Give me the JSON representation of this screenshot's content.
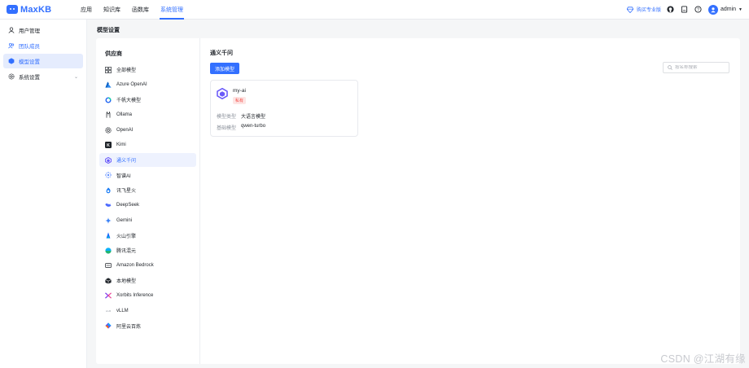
{
  "app": {
    "logo_text": "MaxKB"
  },
  "topnav": {
    "items": [
      {
        "label": "应用",
        "active": false
      },
      {
        "label": "知识库",
        "active": false
      },
      {
        "label": "函数库",
        "active": false
      },
      {
        "label": "系统管理",
        "active": true
      }
    ]
  },
  "topright": {
    "upgrade_label": "购买专业版",
    "username": "admin",
    "icons": [
      "diamond-icon",
      "github-icon",
      "document-icon",
      "help-icon"
    ]
  },
  "sidebar": {
    "items": [
      {
        "label": "用户管理",
        "icon": "user-icon",
        "active": false
      },
      {
        "label": "团队成员",
        "icon": "team-icon",
        "active": false
      },
      {
        "label": "模型设置",
        "icon": "model-icon",
        "active": true
      },
      {
        "label": "系统设置",
        "icon": "gear-icon",
        "active": false,
        "expandable": true
      }
    ]
  },
  "page": {
    "title": "模型设置"
  },
  "providers": {
    "title": "供应商",
    "items": [
      {
        "label": "全部模型",
        "icon": "grid-icon"
      },
      {
        "label": "Azure OpenAI",
        "icon": "azure-icon"
      },
      {
        "label": "千帆大模型",
        "icon": "qianfan-icon"
      },
      {
        "label": "Ollama",
        "icon": "ollama-icon"
      },
      {
        "label": "OpenAI",
        "icon": "openai-icon"
      },
      {
        "label": "Kimi",
        "icon": "kimi-icon"
      },
      {
        "label": "通义千问",
        "icon": "tongyi-icon",
        "active": true
      },
      {
        "label": "智谱AI",
        "icon": "zhipu-icon"
      },
      {
        "label": "讯飞星火",
        "icon": "xunfei-icon"
      },
      {
        "label": "DeepSeek",
        "icon": "deepseek-icon"
      },
      {
        "label": "Gemini",
        "icon": "gemini-icon"
      },
      {
        "label": "火山引擎",
        "icon": "volcano-icon"
      },
      {
        "label": "腾讯混元",
        "icon": "hunyuan-icon"
      },
      {
        "label": "Amazon Bedrock",
        "icon": "bedrock-icon"
      },
      {
        "label": "本地模型",
        "icon": "local-model-icon"
      },
      {
        "label": "Xorbits Inference",
        "icon": "xorbits-icon"
      },
      {
        "label": "vLLM",
        "icon": "vllm-icon"
      },
      {
        "label": "阿里云百炼",
        "icon": "bailian-icon"
      }
    ]
  },
  "main": {
    "title": "通义千问",
    "add_button": "添加模型",
    "search_placeholder": "按名称搜索",
    "card": {
      "name": "my-ai",
      "badge": "私有",
      "type_label": "模型类型",
      "type_value": "大语言模型",
      "base_label": "基础模型",
      "base_value": "qwen-turbo"
    }
  },
  "watermark": "CSDN @江湖有缘",
  "colors": {
    "accent": "#3370ff",
    "badge_bg": "#fde5e4",
    "badge_text": "#f54a45"
  }
}
